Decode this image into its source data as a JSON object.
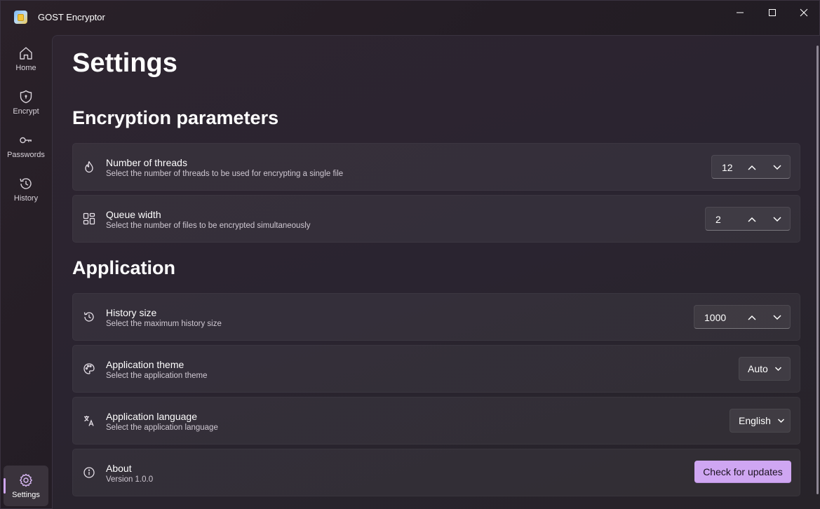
{
  "window": {
    "title": "GOST Encryptor"
  },
  "nav": {
    "items": [
      {
        "label": "Home",
        "icon": "home-icon"
      },
      {
        "label": "Encrypt",
        "icon": "shield-icon"
      },
      {
        "label": "Passwords",
        "icon": "key-icon"
      },
      {
        "label": "History",
        "icon": "history-icon"
      }
    ],
    "settings": {
      "label": "Settings",
      "icon": "gear-icon",
      "active": true
    }
  },
  "page": {
    "title": "Settings"
  },
  "sections": {
    "encryption": {
      "title": "Encryption parameters",
      "threads": {
        "title": "Number of threads",
        "description": "Select the number of threads to be used for encrypting a single file",
        "value": "12"
      },
      "queue": {
        "title": "Queue width",
        "description": "Select the number of files to be encrypted simultaneously",
        "value": "2"
      }
    },
    "application": {
      "title": "Application",
      "history": {
        "title": "History size",
        "description": "Select the maximum history size",
        "value": "1000"
      },
      "theme": {
        "title": "Application theme",
        "description": "Select the application theme",
        "value": "Auto"
      },
      "language": {
        "title": "Application language",
        "description": "Select the application language",
        "value": "English"
      },
      "about": {
        "title": "About",
        "description": "Version 1.0.0",
        "button": "Check for updates"
      }
    }
  },
  "colors": {
    "accent": "#cfa6f2",
    "background": "#2b2530"
  }
}
